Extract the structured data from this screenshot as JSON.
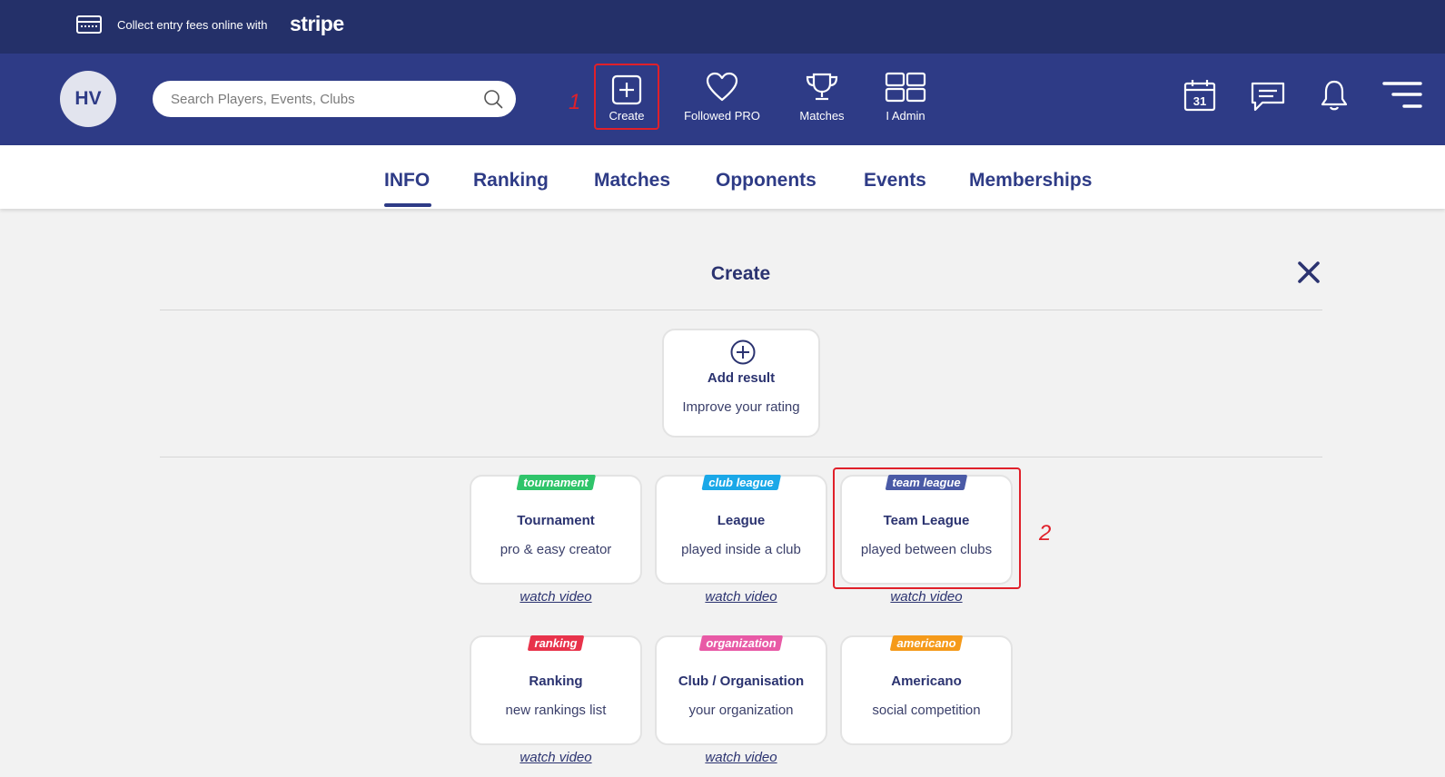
{
  "promo": {
    "text": "Collect entry fees online with",
    "brand": "stripe"
  },
  "header": {
    "avatar_initials": "HV",
    "search_placeholder": "Search Players, Events, Clubs",
    "nav": {
      "create": "Create",
      "followed": "Followed PRO",
      "matches": "Matches",
      "admin": "I Admin"
    },
    "step1": "1",
    "calendar_day": "31"
  },
  "tabs": [
    "INFO",
    "Ranking",
    "Matches",
    "Opponents",
    "Events",
    "Memberships"
  ],
  "panel": {
    "title": "Create",
    "add_result": {
      "title": "Add result",
      "subtitle": "Improve your rating"
    },
    "step2": "2",
    "watch_label": "watch video",
    "cards": [
      {
        "tag": "tournament",
        "tag_color": "#2fc46a",
        "title": "Tournament",
        "subtitle": "pro & easy creator"
      },
      {
        "tag": "club league",
        "tag_color": "#1aa8e8",
        "title": "League",
        "subtitle": "played inside a club"
      },
      {
        "tag": "team league",
        "tag_color": "#4a5aa6",
        "title": "Team League",
        "subtitle": "played between clubs"
      },
      {
        "tag": "ranking",
        "tag_color": "#e8334b",
        "title": "Ranking",
        "subtitle": "new rankings list"
      },
      {
        "tag": "organization",
        "tag_color": "#e85aa6",
        "title": "Club / Organisation",
        "subtitle": "your organization"
      },
      {
        "tag": "americano",
        "tag_color": "#f59a1a",
        "title": "Americano",
        "subtitle": "social competition"
      }
    ]
  },
  "colors": {
    "navy": "#2e3b86",
    "dark_navy": "#243069",
    "highlight_red": "#e0202a"
  }
}
